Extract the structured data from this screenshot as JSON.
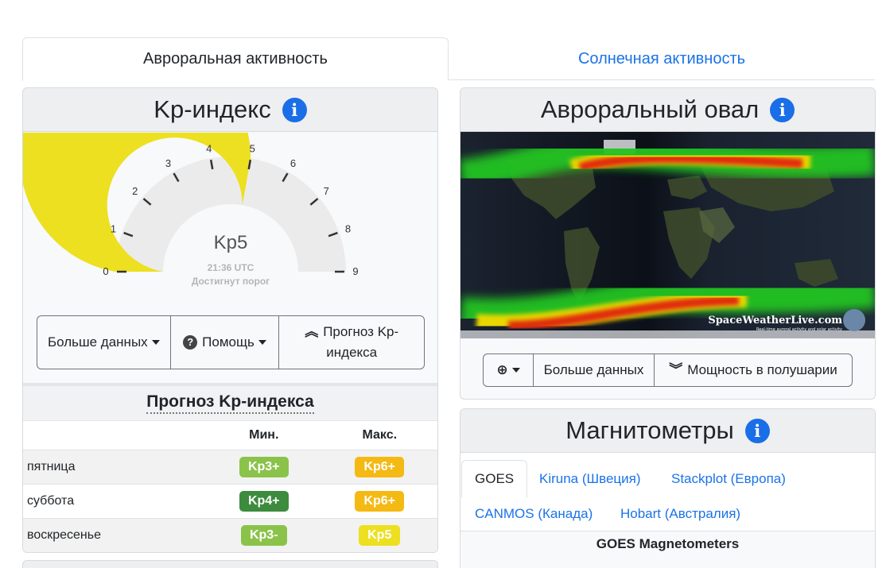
{
  "tabs": [
    {
      "label": "Авроральная активность",
      "active": true
    },
    {
      "label": "Солнечная активность",
      "active": false
    }
  ],
  "kp_card": {
    "title": "Kp-индекс",
    "info_icon": "i",
    "gauge": {
      "value": 5,
      "max": 9,
      "ticks": [
        "0",
        "1",
        "2",
        "3",
        "4",
        "5",
        "6",
        "7",
        "8",
        "9"
      ],
      "label": "Kp5",
      "time": "21:36 UTC",
      "status": "Достигнут порог",
      "fill_color": "#ece021",
      "track_color": "#ebebeb"
    },
    "buttons": {
      "more_data": "Больше данных",
      "help": "Помощь",
      "forecast_1": "Прогноз Kp-",
      "forecast_2": "индекса"
    },
    "forecast": {
      "title": "Прогноз Kp-индекса",
      "col_min": "Мин.",
      "col_max": "Макс.",
      "rows": [
        {
          "day": "пятница",
          "min": "Kp3+",
          "min_color": "#8bc34a",
          "max": "Kp6+",
          "max_color": "#f5b914"
        },
        {
          "day": "суббота",
          "min": "Kp4+",
          "min_color": "#3d8b3d",
          "max": "Kp6+",
          "max_color": "#f5b914"
        },
        {
          "day": "воскресенье",
          "min": "Kp3-",
          "min_color": "#8bc34a",
          "max": "Kp5",
          "max_color": "#ece021"
        }
      ]
    }
  },
  "oval_card": {
    "title": "Авроральный овал",
    "info_icon": "i",
    "watermark": "SpaceWeatherLive.com",
    "watermark_sub": "Real-time auroral activity and solar activity",
    "buttons": {
      "zoom": "zoom",
      "more_data": "Больше данных",
      "hemisphere": "Мощность в полушарии"
    }
  },
  "mag_card": {
    "title": "Магнитометры",
    "info_icon": "i",
    "tabs": [
      "GOES",
      "Kiruna (Швеция)",
      "Stackplot (Европа)",
      "CANMOS (Канада)",
      "Hobart (Австралия)"
    ],
    "content_title": "GOES Magnetometers"
  }
}
